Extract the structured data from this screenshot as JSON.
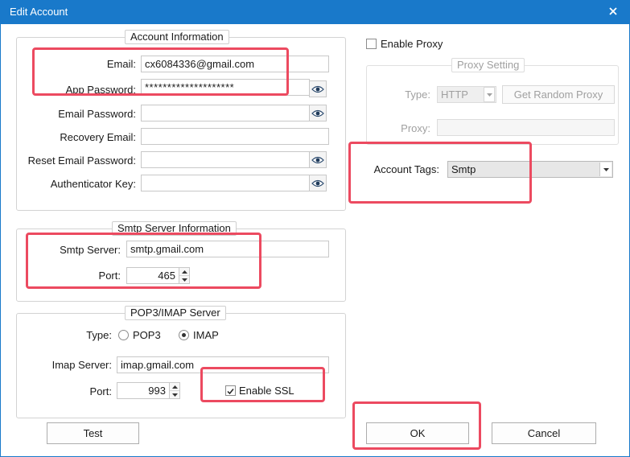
{
  "window": {
    "title": "Edit Account"
  },
  "account": {
    "legend": "Account Information",
    "email_label": "Email:",
    "email_value": "cx6084336@gmail.com",
    "app_password_label": "App Password:",
    "app_password_value": "********************",
    "email_password_label": "Email Password:",
    "email_password_value": "",
    "recovery_email_label": "Recovery Email:",
    "recovery_email_value": "",
    "reset_email_password_label": "Reset Email Password:",
    "reset_email_password_value": "",
    "authenticator_key_label": "Authenticator Key:",
    "authenticator_key_value": ""
  },
  "smtp": {
    "legend": "Smtp Server Information",
    "server_label": "Smtp Server:",
    "server_value": "smtp.gmail.com",
    "port_label": "Port:",
    "port_value": "465"
  },
  "pop_imap": {
    "legend": "POP3/IMAP Server",
    "type_label": "Type:",
    "option_pop3": "POP3",
    "option_imap": "IMAP",
    "selected_type": "IMAP",
    "server_label": "Imap Server:",
    "server_value": "imap.gmail.com",
    "port_label": "Port:",
    "port_value": "993",
    "ssl_label": "Enable SSL",
    "ssl_checked": true
  },
  "proxy": {
    "enable_label": "Enable Proxy",
    "enable_checked": false,
    "legend": "Proxy Setting",
    "type_label": "Type:",
    "type_value": "HTTP",
    "random_button": "Get Random Proxy",
    "proxy_label": "Proxy:",
    "proxy_value": ""
  },
  "tags": {
    "label": "Account Tags:",
    "value": "Smtp"
  },
  "buttons": {
    "test": "Test",
    "ok": "OK",
    "cancel": "Cancel"
  },
  "colors": {
    "titlebar": "#1979ca",
    "highlight": "#ec4a60",
    "tag_combo_bg": "#e7e7e7"
  },
  "icons": [
    "close-icon",
    "eye-icon",
    "spin-up-icon",
    "spin-down-icon",
    "dropdown-arrow-icon",
    "checkmark-icon"
  ]
}
